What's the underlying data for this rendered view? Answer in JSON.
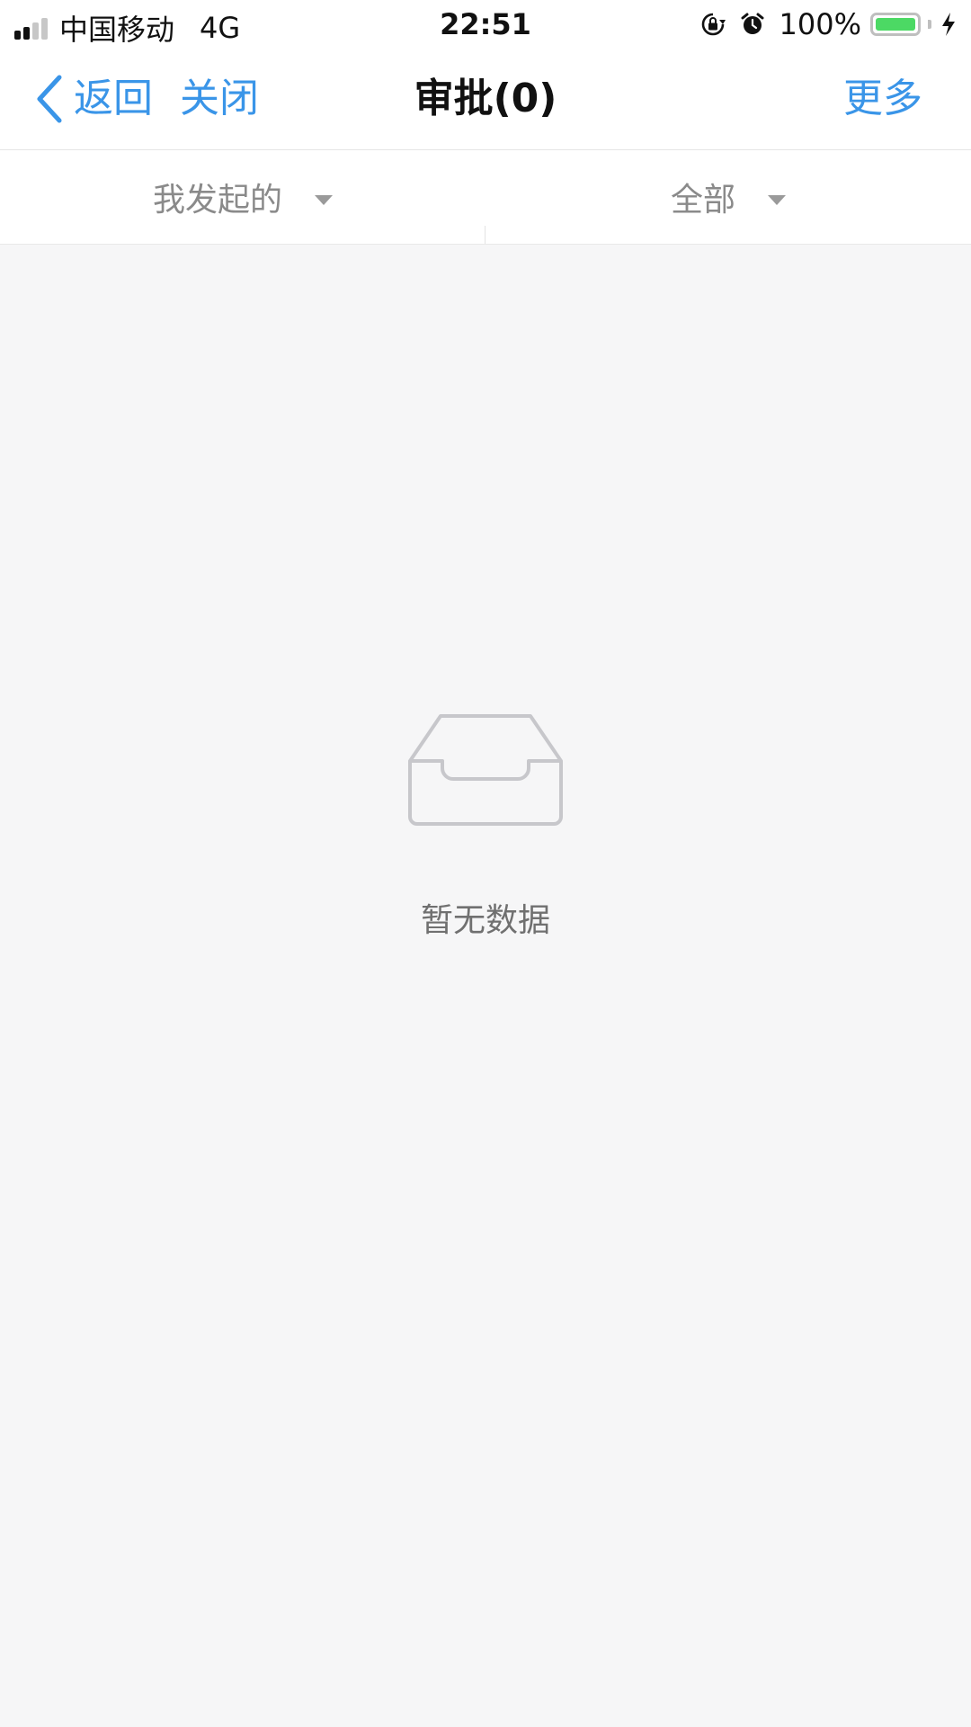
{
  "status_bar": {
    "carrier": "中国移动",
    "network": "4G",
    "time": "22:51",
    "battery": "100%",
    "battery_level": 1.0,
    "icons": [
      "signal-icon",
      "rotation-lock-icon",
      "alarm-icon",
      "battery-icon",
      "charging-icon"
    ]
  },
  "nav": {
    "back_label": "返回",
    "close_label": "关闭",
    "title": "审批(0)",
    "more_label": "更多",
    "accent_color": "#3a95e8"
  },
  "filters": {
    "left_label": "我发起的",
    "right_label": "全部",
    "icon": "dropdown-caret-icon"
  },
  "empty_state": {
    "icon": "empty-inbox-icon",
    "text": "暂无数据"
  }
}
